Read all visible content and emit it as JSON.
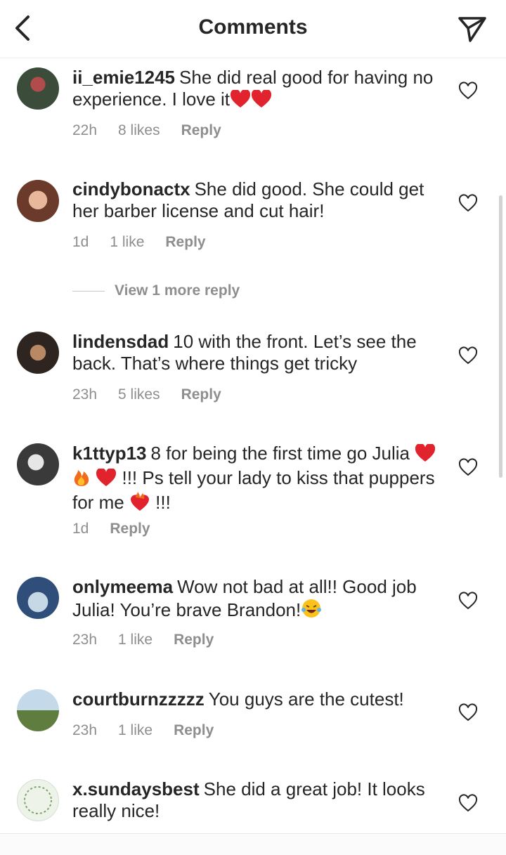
{
  "header": {
    "title": "Comments"
  },
  "comments": [
    {
      "user": "ii_emie1245",
      "text": "She did real good for having no experience. I love it",
      "time": "22h",
      "likes": "8 likes",
      "reply": "Reply"
    },
    {
      "user": "cindybonactx",
      "text": "She did good. She could get her barber license and cut hair!",
      "time": "1d",
      "likes": "1 like",
      "reply": "Reply"
    },
    {
      "user": "lindensdad",
      "text": "10 with the front. Let’s see the back. That’s where things get tricky",
      "time": "23h",
      "likes": "5 likes",
      "reply": "Reply"
    },
    {
      "user": "k1ttyp13",
      "text_a": "8 for being the first time go Julia",
      "text_b": "!!! Ps tell your lady to kiss that puppers for me",
      "text_c": "!!!",
      "time": "1d",
      "reply": "Reply"
    },
    {
      "user": "onlymeema",
      "text": "Wow not bad at all!! Good job Julia! You’re brave Brandon!",
      "time": "23h",
      "likes": "1 like",
      "reply": "Reply"
    },
    {
      "user": "courtburnzzzzz",
      "text": "You guys are the cutest!",
      "time": "23h",
      "likes": "1 like",
      "reply": "Reply"
    },
    {
      "user": "x.sundaysbest",
      "text": "She did a great job! It looks really nice!"
    }
  ],
  "view_more": "View 1 more reply",
  "colors": {
    "text": "#262626",
    "meta": "#8e8e8e",
    "heart_red": "#e0232d"
  }
}
